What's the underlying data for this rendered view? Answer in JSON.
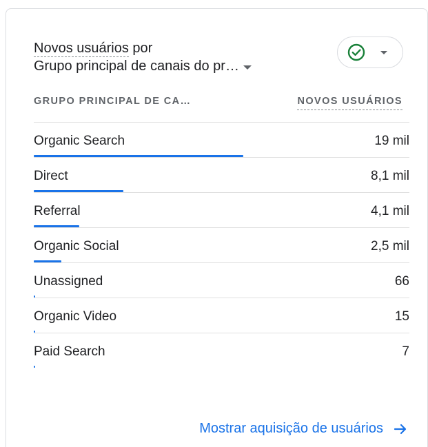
{
  "card": {
    "title_part1": "Novos usuários",
    "title_part2": " por",
    "dimension_selector": "Grupo principal de canais do pr…",
    "status_icon": "check-circle-icon",
    "accent_color": "#1a73e8",
    "success_color": "#188038"
  },
  "table": {
    "col_dimension": "GRUPO PRINCIPAL DE CA…",
    "col_metric": "NOVOS USUÁRIOS",
    "rows": [
      {
        "label": "Organic Search",
        "value": "19 mil",
        "share": 1.0
      },
      {
        "label": "Direct",
        "value": "8,1 mil",
        "share": 0.426
      },
      {
        "label": "Referral",
        "value": "4,1 mil",
        "share": 0.216
      },
      {
        "label": "Organic Social",
        "value": "2,5 mil",
        "share": 0.132
      },
      {
        "label": "Unassigned",
        "value": "66",
        "share": 0.0035
      },
      {
        "label": "Organic Video",
        "value": "15",
        "share": 0.0008
      },
      {
        "label": "Paid Search",
        "value": "7",
        "share": 0.0004
      }
    ]
  },
  "footer": {
    "link_label": "Mostrar aquisição de usuários",
    "link_icon": "arrow-right-icon"
  }
}
